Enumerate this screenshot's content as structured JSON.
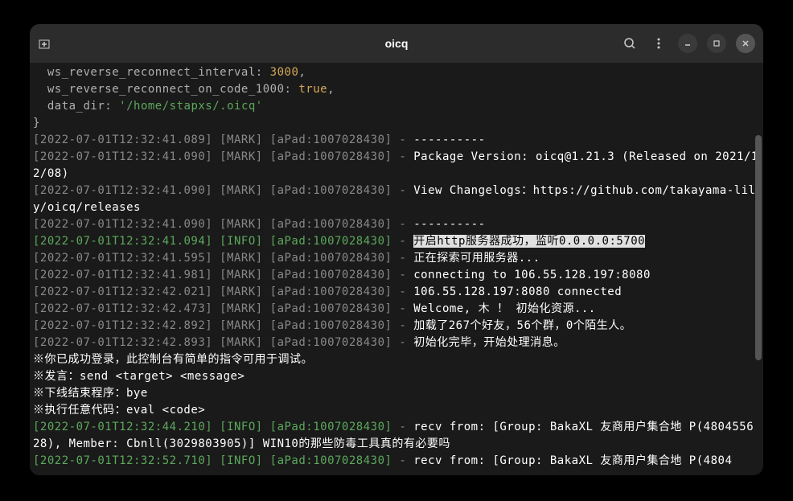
{
  "window": {
    "title": "oicq"
  },
  "config": {
    "ws_reverse_reconnect_interval_key": "ws_reverse_reconnect_interval",
    "ws_reverse_reconnect_interval": "3000",
    "ws_reverse_reconnect_on_code_1000_key": "ws_reverse_reconnect_on_code_1000",
    "ws_reverse_reconnect_on_code_1000": "true",
    "data_dir_key": "data_dir",
    "data_dir": "'/home/stapxs/.oicq'"
  },
  "logs": [
    {
      "ts": "[2022-07-01T12:32:41.089]",
      "level": "[MARK]",
      "src": "[aPad:1007028430]",
      "dash": " - ",
      "msg": "----------",
      "level_class": "gray"
    },
    {
      "ts": "[2022-07-01T12:32:41.090]",
      "level": "[MARK]",
      "src": "[aPad:1007028430]",
      "dash": " - ",
      "msg": "Package Version: oicq@1.21.3 (Released on 2021/12/08)",
      "level_class": "gray"
    },
    {
      "ts": "[2022-07-01T12:32:41.090]",
      "level": "[MARK]",
      "src": "[aPad:1007028430]",
      "dash": " - ",
      "msg": "View Changelogs：https://github.com/takayama-lily/oicq/releases",
      "level_class": "gray"
    },
    {
      "ts": "[2022-07-01T12:32:41.090]",
      "level": "[MARK]",
      "src": "[aPad:1007028430]",
      "dash": " - ",
      "msg": "----------",
      "level_class": "gray"
    },
    {
      "ts": "[2022-07-01T12:32:41.094]",
      "level": "[INFO]",
      "src": "[aPad:1007028430]",
      "dash": " - ",
      "msg": "开启http服务器成功，监听0.0.0.0:5700",
      "level_class": "green",
      "highlight": true
    },
    {
      "ts": "[2022-07-01T12:32:41.595]",
      "level": "[MARK]",
      "src": "[aPad:1007028430]",
      "dash": " - ",
      "msg": "正在探索可用服务器...",
      "level_class": "gray"
    },
    {
      "ts": "[2022-07-01T12:32:41.981]",
      "level": "[MARK]",
      "src": "[aPad:1007028430]",
      "dash": " - ",
      "msg": "connecting to 106.55.128.197:8080",
      "level_class": "gray"
    },
    {
      "ts": "[2022-07-01T12:32:42.021]",
      "level": "[MARK]",
      "src": "[aPad:1007028430]",
      "dash": " - ",
      "msg": "106.55.128.197:8080 connected",
      "level_class": "gray"
    },
    {
      "ts": "[2022-07-01T12:32:42.473]",
      "level": "[MARK]",
      "src": "[aPad:1007028430]",
      "dash": " - ",
      "msg": "Welcome, 木 ！ 初始化资源...",
      "level_class": "gray"
    },
    {
      "ts": "[2022-07-01T12:32:42.892]",
      "level": "[MARK]",
      "src": "[aPad:1007028430]",
      "dash": " - ",
      "msg": "加载了267个好友，56个群，0个陌生人。",
      "level_class": "gray"
    },
    {
      "ts": "[2022-07-01T12:32:42.893]",
      "level": "[MARK]",
      "src": "[aPad:1007028430]",
      "dash": " - ",
      "msg": "初始化完毕，开始处理消息。",
      "level_class": "gray"
    }
  ],
  "help": {
    "l1": "※你已成功登录，此控制台有简单的指令可用于调试。",
    "l2": "※发言：send <target> <message>",
    "l3": "※下线结束程序：bye",
    "l4": "※执行任意代码：eval <code>"
  },
  "trailing": [
    {
      "ts": "[2022-07-01T12:32:44.210]",
      "level": "[INFO]",
      "src": "[aPad:1007028430]",
      "dash": " - ",
      "msg": "recv from: [Group: BakaXL 友商用户集合地 P(480455628), Member: Cbnll(3029803905)] WIN10的那些防毒工具真的有必要吗",
      "level_class": "green"
    },
    {
      "ts": "[2022-07-01T12:32:52.710]",
      "level": "[INFO]",
      "src": "[aPad:1007028430]",
      "dash": " - ",
      "msg": "recv from: [Group: BakaXL 友商用户集合地 P(4804",
      "level_class": "green"
    }
  ]
}
